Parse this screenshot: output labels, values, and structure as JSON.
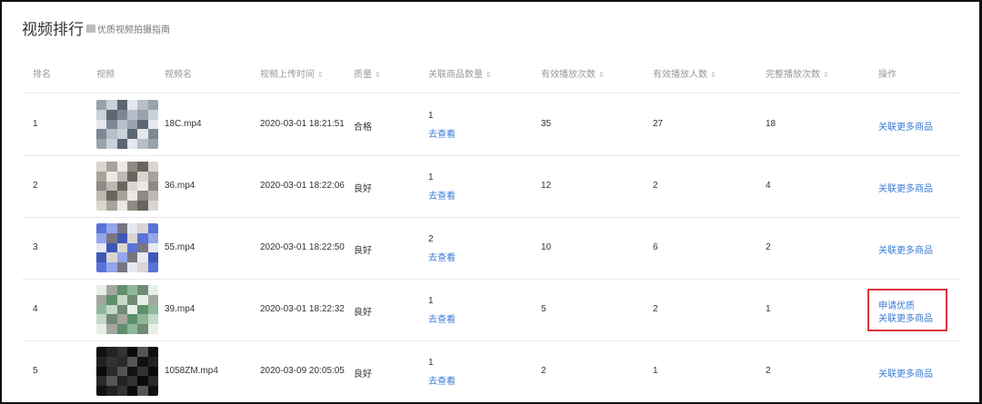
{
  "title": "视频排行",
  "guide_link": "优质视频拍摄指南",
  "columns": [
    {
      "label": "排名",
      "sortable": false
    },
    {
      "label": "视频",
      "sortable": false
    },
    {
      "label": "视频名",
      "sortable": false
    },
    {
      "label": "视频上传时间",
      "sortable": true
    },
    {
      "label": "质量",
      "sortable": true
    },
    {
      "label": "关联商品数量",
      "sortable": true
    },
    {
      "label": "有效播放次数",
      "sortable": true
    },
    {
      "label": "有效播放人数",
      "sortable": true
    },
    {
      "label": "完整播放次数",
      "sortable": true
    },
    {
      "label": "操作",
      "sortable": false
    }
  ],
  "sort_glyph": "⇕",
  "view_link": "去查看",
  "rows": [
    {
      "rank": "1",
      "name": "18C.mp4",
      "time": "2020-03-01 18:21:51",
      "quality": "合格",
      "products": "1",
      "plays": "35",
      "viewers": "27",
      "complete": "18",
      "actions": [
        "关联更多商品"
      ],
      "palette": [
        "#9aa3ad",
        "#c9d1da",
        "#5c6773",
        "#e4e8ee",
        "#7d8893",
        "#b6bfc9"
      ]
    },
    {
      "rank": "2",
      "name": "36.mp4",
      "time": "2020-03-01 18:22:06",
      "quality": "良好",
      "products": "1",
      "plays": "12",
      "viewers": "2",
      "complete": "4",
      "actions": [
        "关联更多商品"
      ],
      "palette": [
        "#8e8a84",
        "#bdb8b1",
        "#6a665f",
        "#d9d6d0",
        "#a7a29a",
        "#ece9e4"
      ]
    },
    {
      "rank": "3",
      "name": "55.mp4",
      "time": "2020-03-01 18:22:50",
      "quality": "良好",
      "products": "2",
      "plays": "10",
      "viewers": "6",
      "complete": "2",
      "actions": [
        "关联更多商品"
      ],
      "palette": [
        "#5b72d8",
        "#93a6ec",
        "#7a7680",
        "#e6e9f3",
        "#4057b8",
        "#d8d6cf"
      ]
    },
    {
      "rank": "4",
      "name": "39.mp4",
      "time": "2020-03-01 18:22:32",
      "quality": "良好",
      "products": "1",
      "plays": "5",
      "viewers": "2",
      "complete": "1",
      "actions": [
        "申请优质",
        "关联更多商品"
      ],
      "palette": [
        "#8fb89b",
        "#c4d9c8",
        "#6f8a76",
        "#e8efe9",
        "#a3a79e",
        "#5f8f6b"
      ]
    },
    {
      "rank": "5",
      "name": "1058ZM.mp4",
      "time": "2020-03-09 20:05:05",
      "quality": "良好",
      "products": "1",
      "plays": "2",
      "viewers": "1",
      "complete": "2",
      "actions": [
        "关联更多商品"
      ],
      "palette": [
        "#111111",
        "#222222",
        "#333333",
        "#0a0a0a",
        "#2a2a2a",
        "#555555"
      ]
    }
  ]
}
